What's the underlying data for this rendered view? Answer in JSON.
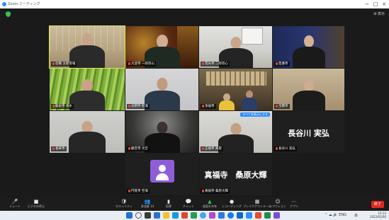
{
  "window": {
    "title": "Zoom ミーティング",
    "minimize": "−",
    "maximize": "□",
    "close": "×"
  },
  "header": {
    "view_label": "⊞ 表示"
  },
  "tiles": [
    {
      "name": "住職 太郎雪嶺",
      "muted": true,
      "active": true
    },
    {
      "name": "大悲寺 一郎宗山",
      "muted": true
    },
    {
      "name": "常光寺 二郎宗心",
      "muted": true
    },
    {
      "name": "西蓮寺",
      "muted": true
    },
    {
      "name": "龍泉寺 清水",
      "muted": true
    },
    {
      "name": "光明寺 智海",
      "muted": true
    },
    {
      "name": "浄福寺",
      "muted": true
    },
    {
      "name": "宝積寺",
      "muted": true
    },
    {
      "name": "長寿寺",
      "muted": true
    },
    {
      "name": "観音寺 大空",
      "muted": true
    },
    {
      "name": "正福寺 真聖",
      "muted": true,
      "pill": "すべて非表示にする"
    },
    {
      "name": "長谷川 実弘",
      "muted": true,
      "big_name": "長谷川 実弘"
    },
    {
      "name": "円覚寺 空海",
      "muted": true,
      "avatar": true
    },
    {
      "name": "真福寺 桑原大輝",
      "muted": true,
      "big_name": "真福寺　桑原大輝"
    }
  ],
  "toolbar": {
    "items": [
      {
        "icon": "🎤",
        "label": "ミュート",
        "name": "mute-button",
        "icon_name": "microphone-icon"
      },
      {
        "icon": "■",
        "label": "ビデオの停止",
        "name": "stop-video-button",
        "icon_name": "video-camera-icon"
      },
      {
        "icon": "🛡",
        "label": "セキュリティ",
        "name": "security-button",
        "icon_name": "shield-icon"
      },
      {
        "icon": "👥",
        "label": "参加者 14",
        "name": "participants-button",
        "icon_name": "participants-icon"
      },
      {
        "icon": "▮",
        "label": "投票",
        "name": "polls-button",
        "icon_name": "poll-icon"
      },
      {
        "icon": "💬",
        "label": "チャット",
        "name": "chat-button",
        "icon_name": "chat-icon"
      },
      {
        "icon": "▲",
        "label": "画面を共有",
        "name": "share-screen-button",
        "icon_name": "share-screen-icon"
      },
      {
        "icon": "●",
        "label": "レコーディング",
        "name": "record-button",
        "icon_name": "record-icon"
      },
      {
        "icon": "▦",
        "label": "ブレイクアウトルーム",
        "name": "breakout-rooms-button",
        "icon_name": "breakout-rooms-icon"
      },
      {
        "icon": "☺",
        "label": "リアクション",
        "name": "reactions-button",
        "icon_name": "reactions-icon"
      },
      {
        "icon": "⋯",
        "label": "アプリ",
        "name": "apps-button",
        "icon_name": "apps-icon"
      }
    ],
    "end_label": "終了"
  },
  "taskbar": {
    "time": "15:13",
    "date": "2022/02/06",
    "lang": "あ",
    "tray_indicator": "⌃ ☁ 🔊 ENG"
  },
  "colors": {
    "accent": "#2d8cff",
    "end_red": "#e0271f",
    "active_border": "#d8e84a"
  }
}
